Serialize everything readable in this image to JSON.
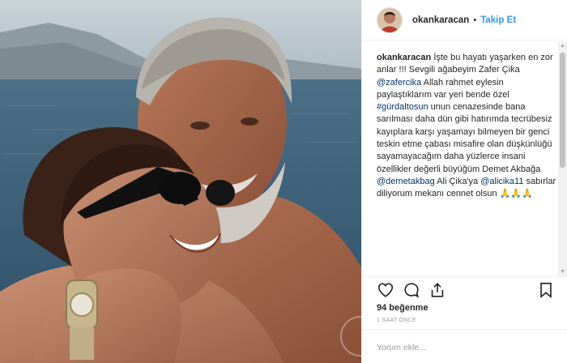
{
  "post": {
    "username": "okankaracan",
    "follow_separator": "•",
    "follow_label": "Takip Et",
    "caption": {
      "user": "okankaracan",
      "text_1": " İşte bu hayatı yaşarken en zor anlar !!! Sevgili ağabeyim Zafer Çika ",
      "mention_1": "@zafercika",
      "text_2": " Allah rahmet eylesin paylaştıklarım var yeri bende özel ",
      "hashtag_1": "#gürdaltosun",
      "text_3": " unun cenazesinde bana sarılması daha dün gibi hatırımda tecrübesiz kayıplara karşı yaşamayı bilmeyen bir genci teskin etme çabası misafire olan düşkünlüğü sayamayacağım daha yüzlerce insani özellikler değerli büyüğüm Demet Akbağa ",
      "mention_2": "@demetakbag",
      "text_4": " Ali Çika'ya ",
      "mention_3": "@alicika11",
      "text_5": " sabırlar diliyorum mekanı cennet olsun 🙏🙏🙏"
    },
    "likes": "94 beğenme",
    "time": "1 SAAT ÖNCE",
    "comment_placeholder": "Yorum ekle..."
  },
  "scrollbar": {
    "up_arrow": "▲",
    "down_arrow": "▼"
  },
  "icons": {
    "like": "heart-icon",
    "comment": "comment-icon",
    "share": "share-icon",
    "save": "bookmark-icon"
  },
  "colors": {
    "link": "#003569",
    "follow": "#3897f0",
    "text": "#262626",
    "muted": "#999999"
  }
}
